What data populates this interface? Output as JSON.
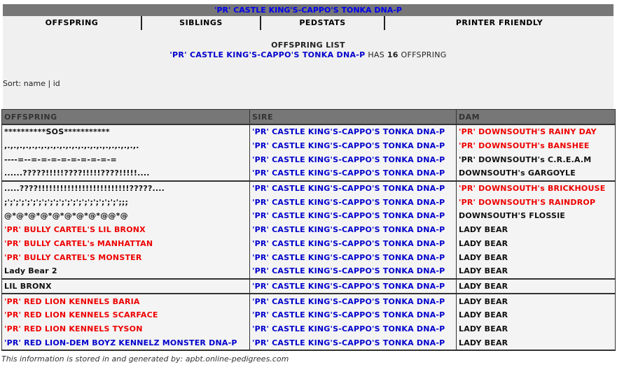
{
  "header": {
    "title": "'PR' CASTLE KING'S-CAPPO'S TONKA DNA-P",
    "title_color": "#0000ee",
    "bar_color": "#777777"
  },
  "tabs": [
    {
      "label": "OFFSPRING"
    },
    {
      "label": "SIBLINGS"
    },
    {
      "label": "PEDSTATS"
    },
    {
      "label": "PRINTER FRIENDLY"
    }
  ],
  "summary": {
    "list_title": "OFFSPRING LIST",
    "dog_name": "'PR' CASTLE KING'S-CAPPO'S TONKA DNA-P",
    "has_text": "HAS",
    "count": "16",
    "suffix": "OFFSPRING"
  },
  "sort": {
    "prefix": "Sort:",
    "by_name": "name",
    "separator": "|",
    "by_id": "id"
  },
  "table": {
    "headers": [
      "OFFSPRING",
      "SIRE",
      "DAM"
    ],
    "rows": [
      {
        "offspring": "**********SOS***********",
        "offspring_color": "black",
        "sire": "'PR' CASTLE KING'S-CAPPO'S TONKA DNA-P",
        "dam": "'PR' DOWNSOUTH'S RAINY DAY",
        "dam_color": "red",
        "group_start": false
      },
      {
        "offspring": ",.,.,.,.,.,.,.,.,.,.,.,.,.,.,.,.,.,.,.,.,.,.",
        "offspring_color": "black",
        "sire": "'PR' CASTLE KING'S-CAPPO'S TONKA DNA-P",
        "dam": "'PR' DOWNSOUTH's BANSHEE",
        "dam_color": "red",
        "group_start": false
      },
      {
        "offspring": "----=--=-=-=-=-=-=-=-=-=",
        "offspring_color": "black",
        "sire": "'PR' CASTLE KING'S-CAPPO'S TONKA DNA-P",
        "dam": "'PR' DOWNSOUTH's C.R.E.A.M",
        "dam_color": "black",
        "group_start": false
      },
      {
        "offspring": "......?????!!!!!????!!!!!????!!!!!....",
        "offspring_color": "black",
        "sire": "'PR' CASTLE KING'S-CAPPO'S TONKA DNA-P",
        "dam": "DOWNSOUTH's GARGOYLE",
        "dam_color": "black",
        "group_start": false
      },
      {
        "offspring": ".....????!!!!!!!!!!!!!!!!!!!!!!!!!?????....",
        "offspring_color": "black",
        "sire": "'PR' CASTLE KING'S-CAPPO'S TONKA DNA-P",
        "dam": "'PR' DOWNSOUTH's BRICKHOUSE",
        "dam_color": "red",
        "group_start": true
      },
      {
        "offspring": ";';';';';';';';';';';';';';';';';';';';';;;",
        "offspring_color": "black",
        "sire": "'PR' CASTLE KING'S-CAPPO'S TONKA DNA-P",
        "dam": "'PR' DOWNSOUTH'S RAINDROP",
        "dam_color": "red",
        "group_start": false
      },
      {
        "offspring": "@*@*@*@*@*@*@*@*@@*@",
        "offspring_color": "black",
        "sire": "'PR' CASTLE KING'S-CAPPO'S TONKA DNA-P",
        "dam": "DOWNSOUTH'S FLOSSIE",
        "dam_color": "black",
        "group_start": false
      },
      {
        "offspring": "'PR' BULLY CARTEL'S LIL BRONX",
        "offspring_color": "red",
        "sire": "'PR' CASTLE KING'S-CAPPO'S TONKA DNA-P",
        "dam": "LADY BEAR",
        "dam_color": "black",
        "group_start": false
      },
      {
        "offspring": "'PR' BULLY CARTEL's MANHATTAN",
        "offspring_color": "red",
        "sire": "'PR' CASTLE KING'S-CAPPO'S TONKA DNA-P",
        "dam": "LADY BEAR",
        "dam_color": "black",
        "group_start": false
      },
      {
        "offspring": "'PR' BULLY CARTEL'S MONSTER",
        "offspring_color": "red",
        "sire": "'PR' CASTLE KING'S-CAPPO'S TONKA DNA-P",
        "dam": "LADY BEAR",
        "dam_color": "black",
        "group_start": false
      },
      {
        "offspring": "Lady Bear 2",
        "offspring_color": "black",
        "sire": "'PR' CASTLE KING'S-CAPPO'S TONKA DNA-P",
        "dam": "LADY BEAR",
        "dam_color": "black",
        "group_start": false
      },
      {
        "offspring": "LIL BRONX",
        "offspring_color": "black",
        "sire": "'PR' CASTLE KING'S-CAPPO'S TONKA DNA-P",
        "dam": "LADY BEAR",
        "dam_color": "black",
        "group_start": true
      },
      {
        "offspring": "'PR' RED LION KENNELS BARIA",
        "offspring_color": "red",
        "sire": "'PR' CASTLE KING'S-CAPPO'S TONKA DNA-P",
        "dam": "LADY BEAR",
        "dam_color": "black",
        "group_start": true
      },
      {
        "offspring": "'PR' RED LION KENNELS SCARFACE",
        "offspring_color": "red",
        "sire": "'PR' CASTLE KING'S-CAPPO'S TONKA DNA-P",
        "dam": "LADY BEAR",
        "dam_color": "black",
        "group_start": false
      },
      {
        "offspring": "'PR' RED LION KENNELS TYSON",
        "offspring_color": "red",
        "sire": "'PR' CASTLE KING'S-CAPPO'S TONKA DNA-P",
        "dam": "LADY BEAR",
        "dam_color": "black",
        "group_start": false
      },
      {
        "offspring": "'PR' RED LION-DEM BOYZ KENNELZ MONSTER DNA-P",
        "offspring_color": "blue",
        "sire": "'PR' CASTLE KING'S-CAPPO'S TONKA DNA-P",
        "dam": "LADY BEAR",
        "dam_color": "black",
        "group_start": false
      }
    ]
  },
  "footer": {
    "text": "This information is stored in and generated by: apbt.online-pedigrees.com"
  }
}
